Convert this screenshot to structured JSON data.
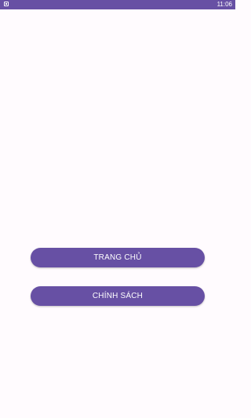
{
  "status_bar": {
    "time": "11:06",
    "notification_icon": "notification-square-icon",
    "color": "#6750a4"
  },
  "buttons": {
    "home_label": "TRANG CHỦ",
    "policy_label": "CHÍNH SÁCH"
  },
  "colors": {
    "accent": "#6750a4",
    "background": "#fffbfe",
    "button_text": "#ffffff"
  }
}
